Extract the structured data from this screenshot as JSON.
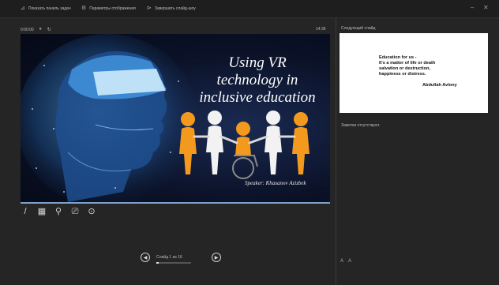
{
  "toolbar": {
    "items": [
      {
        "icon": "taskbar-icon",
        "label": "Показать панель задач"
      },
      {
        "icon": "display-settings-icon",
        "label": "Параметры отображения"
      },
      {
        "icon": "end-slideshow-icon",
        "label": "Завершить слайд-шоу"
      }
    ]
  },
  "presenter": {
    "elapsed": "0:00:00",
    "clock": "14:36"
  },
  "slide": {
    "title": "Using VR\ntechnology in\ninclusive education",
    "speaker": "Speaker: Khasanov Azizbek"
  },
  "tools": [
    {
      "icon": "pen-icon",
      "glyph": "/"
    },
    {
      "icon": "all-slides-icon",
      "glyph": "▦"
    },
    {
      "icon": "zoom-icon",
      "glyph": "⚲"
    },
    {
      "icon": "screen-icon",
      "glyph": "⎚"
    },
    {
      "icon": "more-options-icon",
      "glyph": "⊙"
    }
  ],
  "navigation": {
    "counter": "Слайд 1 из 16",
    "progress": 0.0625
  },
  "next_slide": {
    "label": "Следующий слайд",
    "quote": "Education for us -\nIt's a matter of life or death\nsalvation or destruction,\nhappiness or distress.",
    "author": "Abdullah Avlony"
  },
  "notes": {
    "text": "Заметки отсутствуют."
  },
  "font_controls": [
    "A",
    "A"
  ],
  "colors": {
    "background": "#252525",
    "slide_background": "#0b1228",
    "figure_orange": "#f39a1e",
    "figure_white": "#f2f2f2"
  }
}
